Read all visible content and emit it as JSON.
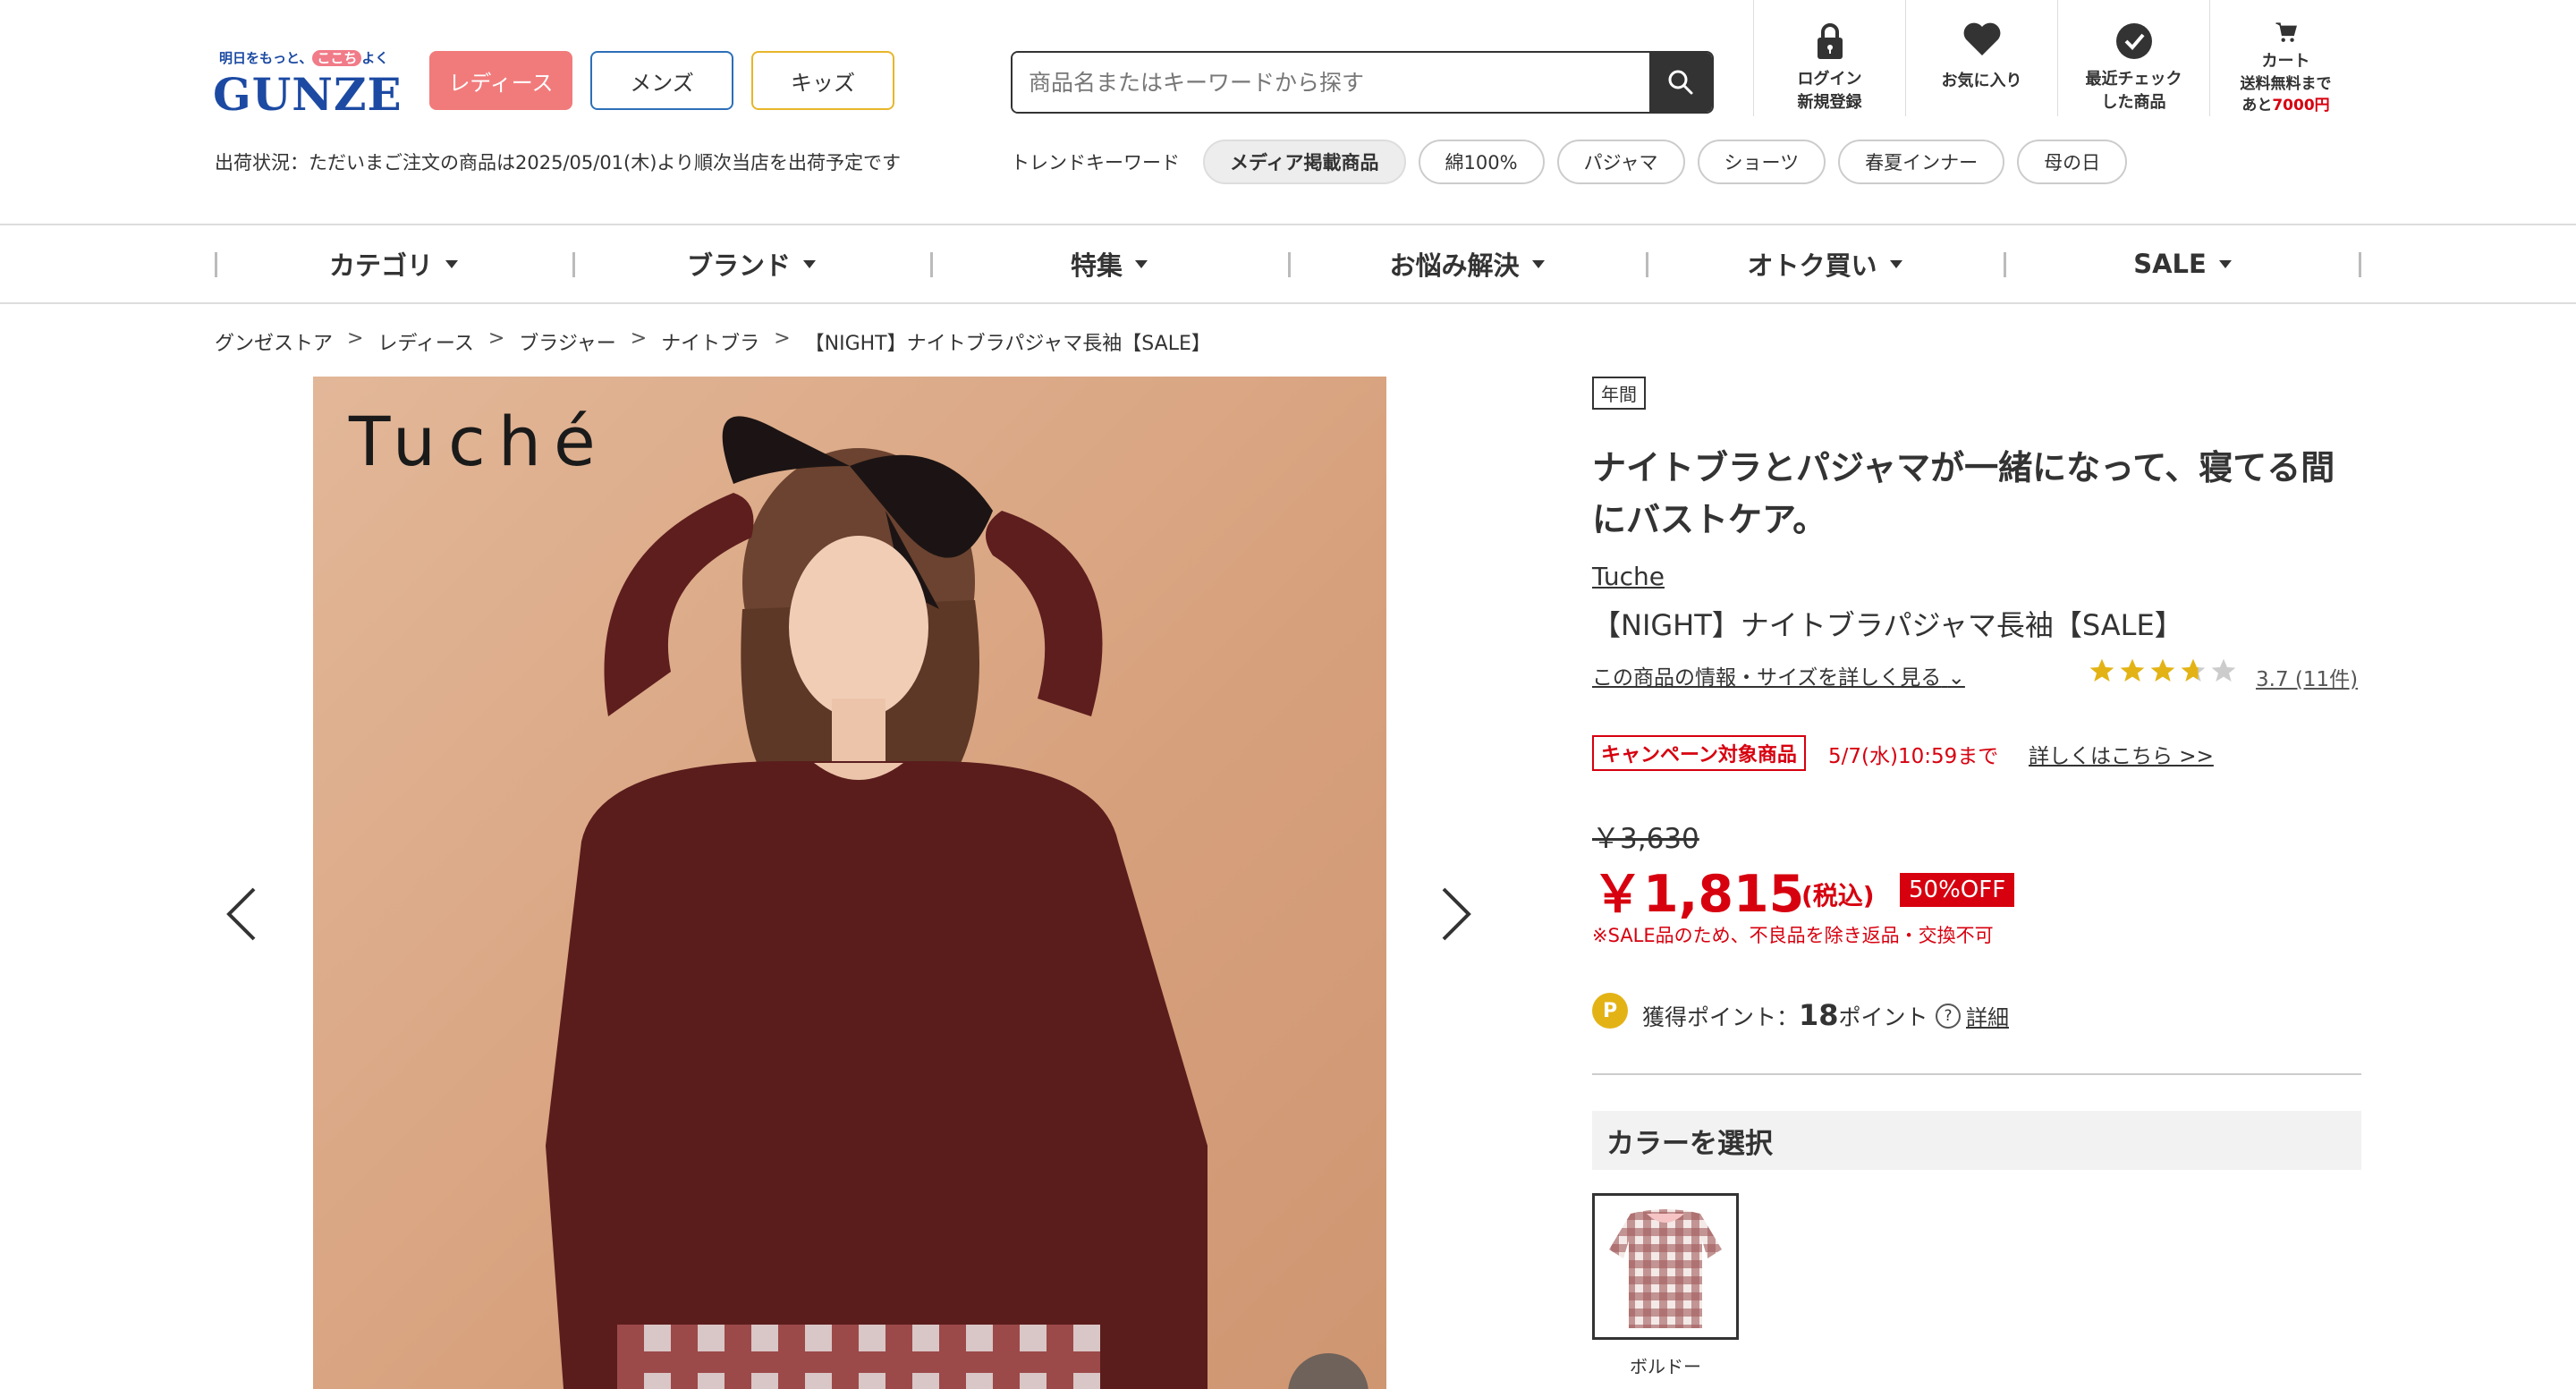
{
  "header": {
    "tagline_1": "明日をもっと、",
    "tagline_2": "ここち",
    "tagline_3": "よく",
    "logo": "GUNZE",
    "tabs": [
      "レディース",
      "メンズ",
      "キッズ"
    ],
    "search_placeholder": "商品名またはキーワードから探す",
    "icons": [
      {
        "name": "login",
        "label": "ログイン\n新規登録"
      },
      {
        "name": "favorite",
        "label": "お気に入り"
      },
      {
        "name": "recent",
        "label": "最近チェック\nした商品"
      },
      {
        "name": "cart",
        "label": "カート"
      }
    ],
    "cart_note_1": "送料無料まで",
    "cart_note_2": "あと",
    "cart_note_3": "7000円",
    "ship_status": "出荷状況：ただいまご注文の商品は2025/05/01(木)より順次当店を出荷予定です",
    "trend_label": "トレンドキーワード",
    "trend_tags": [
      "メディア掲載商品",
      "綿100%",
      "パジャマ",
      "ショーツ",
      "春夏インナー",
      "母の日"
    ]
  },
  "global_nav": [
    "カテゴリ",
    "ブランド",
    "特集",
    "お悩み解決",
    "オトク買い",
    "SALE"
  ],
  "breadcrumb": [
    "グンゼストア",
    "レディース",
    "ブラジャー",
    "ナイトブラ",
    "【NIGHT】ナイトブラパジャマ長袖【SALE】"
  ],
  "product": {
    "image_brand_text": "Tuché",
    "badge": "年間",
    "catch_copy": "ナイトブラとパジャマが一緒になって、寝てる間にバストケア。",
    "brand": "Tuche",
    "name": "【NIGHT】ナイトブラパジャマ長袖【SALE】",
    "detail_link": "この商品の情報・サイズを詳しく見る",
    "rating_value": 3.7,
    "rating_text": "3.7 (11件)",
    "campaign_badge": "キャンペーン対象商品",
    "campaign_date": "5/7(水)10:59まで",
    "campaign_link": "詳しくはこちら >>",
    "old_price": "￥3,630",
    "price": "￥1,815",
    "tax_label": "(税込)",
    "discount": "50%OFF",
    "sale_note": "※SALE品のため、不良品を除き返品・交換不可",
    "points_icon": "P",
    "points_label": "獲得ポイント：",
    "points_value": "18",
    "points_unit": "ポイント",
    "points_help": "詳細",
    "color_heading": "カラーを選択",
    "colors": [
      {
        "label": "ボルドー"
      }
    ]
  },
  "colors": {
    "accent_red": "#d7000f",
    "brand_blue": "#1c4aa3",
    "ladies_pink": "#f17b7b",
    "star": "#e3b316"
  }
}
